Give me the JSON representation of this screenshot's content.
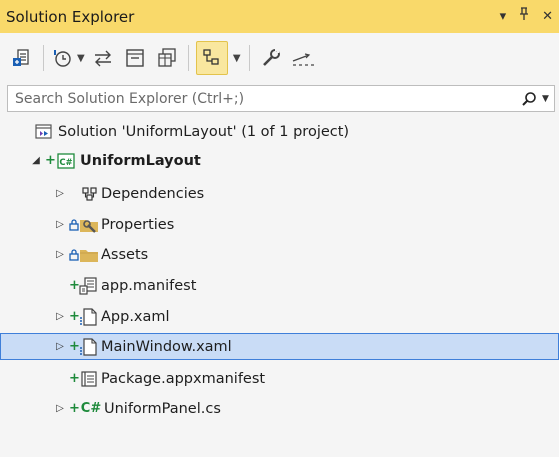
{
  "panel": {
    "title": "Solution Explorer",
    "dropdown_glyph": "▾",
    "pin_glyph": "⊥",
    "close_glyph": "✕"
  },
  "search": {
    "placeholder": "Search Solution Explorer (Ctrl+;)",
    "value": ""
  },
  "tree": {
    "solution_label": "Solution 'UniformLayout' (1 of 1 project)",
    "project_label": "UniformLayout",
    "items": [
      {
        "label": "Dependencies",
        "icon": "dependencies-icon"
      },
      {
        "label": "Properties",
        "icon": "properties-folder-icon"
      },
      {
        "label": "Assets",
        "icon": "folder-icon"
      },
      {
        "label": "app.manifest",
        "icon": "manifest-file-icon"
      },
      {
        "label": "App.xaml",
        "icon": "xaml-file-icon"
      },
      {
        "label": "MainWindow.xaml",
        "icon": "xaml-file-icon"
      },
      {
        "label": "Package.appxmanifest",
        "icon": "appxmanifest-file-icon"
      },
      {
        "label": "UniformPanel.cs",
        "icon": "csharp-file-icon"
      }
    ],
    "cs_glyph": "C#",
    "project_badge": "C#"
  },
  "colors": {
    "title_bar": "#f9d96a",
    "selection_bg": "#c9dcf6",
    "selection_border": "#3f7fd9",
    "added_plus": "#1e8a3b",
    "lock_blue": "#1a5fb4"
  }
}
